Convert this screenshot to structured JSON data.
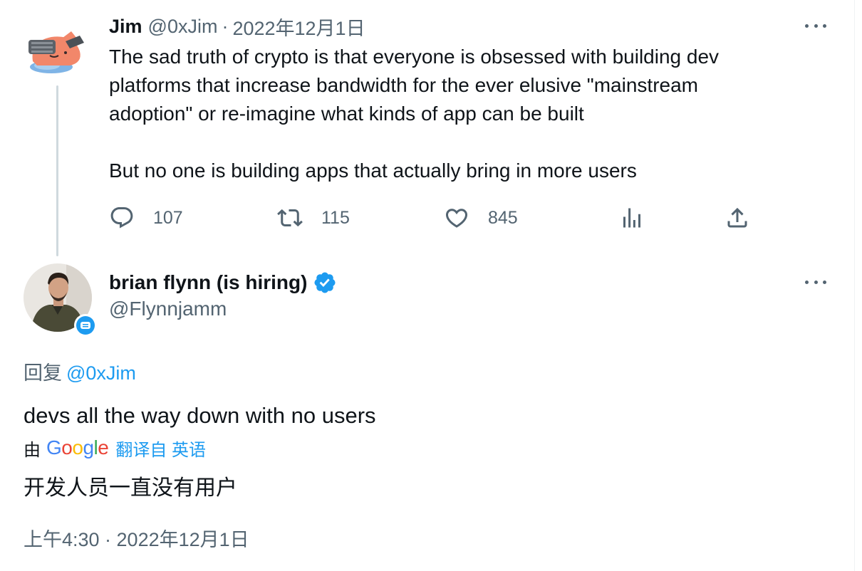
{
  "tweet1": {
    "name": "Jim",
    "handle": "@0xJim",
    "separator": "·",
    "date": "2022年12月1日",
    "text": "The sad truth of crypto is that everyone is obsessed with building dev\nplatforms that increase bandwidth for the ever elusive \"mainstream\nadoption\" or re-imagine what kinds of app can be built\n\nBut no one is building apps that actually bring in more users",
    "replies": "107",
    "retweets": "115",
    "likes": "845",
    "icons": [
      "reply-icon",
      "retweet-icon",
      "like-icon",
      "views-icon",
      "share-icon",
      "more-icon"
    ]
  },
  "tweet2": {
    "name": "brian flynn (is hiring)",
    "handle": "@Flynnjamm",
    "reply_prefix": "回复",
    "reply_mention": "@0xJim",
    "text": "devs all the way down with no users",
    "translate_by": "由",
    "translate_brand": "Google",
    "translate_link": "翻译自 英语",
    "translated_text": "开发人员一直没有用户",
    "timestamp": "上午4:30 · 2022年12月1日",
    "icons": [
      "verified-badge-icon",
      "more-icon"
    ]
  },
  "colors": {
    "accent": "#1d9bf0",
    "text": "#0f1419",
    "muted": "#536471",
    "thread_line": "#cfd9de"
  }
}
